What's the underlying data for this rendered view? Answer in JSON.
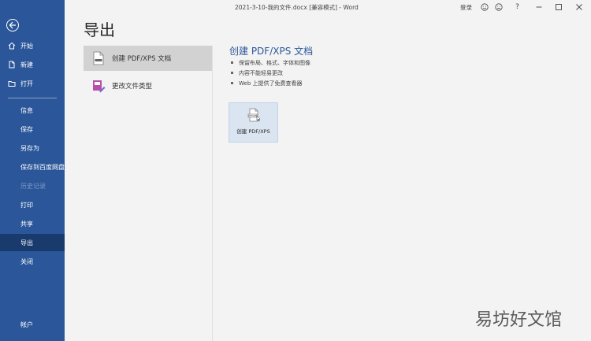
{
  "window": {
    "title": "2021-3-10-我的文件.docx [兼容模式] - Word",
    "login_label": "登录",
    "icons": [
      "smile-icon",
      "frown-icon",
      "help-icon",
      "minimize-icon",
      "maximize-icon",
      "close-icon"
    ]
  },
  "sidebar": {
    "top_items": [
      {
        "label": "开始",
        "icon": "home-icon"
      },
      {
        "label": "新建",
        "icon": "new-document-icon"
      },
      {
        "label": "打开",
        "icon": "open-folder-icon"
      }
    ],
    "items": [
      {
        "label": "信息",
        "disabled": false,
        "active": false
      },
      {
        "label": "保存",
        "disabled": false,
        "active": false
      },
      {
        "label": "另存为",
        "disabled": false,
        "active": false
      },
      {
        "label": "保存到百度网盘",
        "disabled": false,
        "active": false
      },
      {
        "label": "历史记录",
        "disabled": true,
        "active": false
      },
      {
        "label": "打印",
        "disabled": false,
        "active": false
      },
      {
        "label": "共享",
        "disabled": false,
        "active": false
      },
      {
        "label": "导出",
        "disabled": false,
        "active": true
      },
      {
        "label": "关闭",
        "disabled": false,
        "active": false
      }
    ],
    "account_label": "帐户"
  },
  "main": {
    "page_title": "导出",
    "options": [
      {
        "label": "创建 PDF/XPS 文档",
        "selected": true
      },
      {
        "label": "更改文件类型",
        "selected": false
      }
    ],
    "detail": {
      "title": "创建 PDF/XPS 文档",
      "bullets": [
        "保留布局、格式、字体和图像",
        "内容不能轻易更改",
        "Web 上提供了免费查看器"
      ],
      "button_label": "创建 PDF/XPS",
      "doc_badge": "PDF/XPS"
    }
  },
  "watermark": "易坊好文馆",
  "colors": {
    "sidebar": "#2b579a",
    "sidebar_active": "#183a6d",
    "accent": "#2b579a",
    "background": "#f3f3f3",
    "selected_option": "#d2d2d2",
    "pdf_button": "#dbe5f1"
  }
}
